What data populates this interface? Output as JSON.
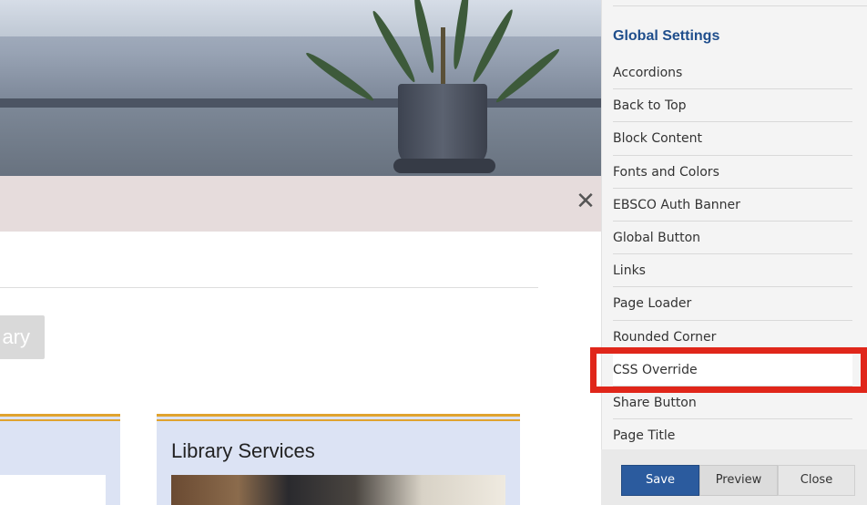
{
  "alert": {
    "close_glyph": "✕"
  },
  "page": {
    "button_partial_label": "ary",
    "card_title": "Library Services"
  },
  "panel": {
    "heading": "Global Settings",
    "items": [
      "Accordions",
      "Back to Top",
      "Block Content",
      "Fonts and Colors",
      "EBSCO Auth Banner",
      "Global Button",
      "Links",
      "Page Loader",
      "Rounded Corner",
      "CSS Override",
      "Share Button",
      "Page Title"
    ],
    "highlighted_item": "CSS Override",
    "highlight_color": "#e0261a"
  },
  "footer": {
    "save_label": "Save",
    "preview_label": "Preview",
    "close_label": "Close"
  },
  "colors": {
    "accent": "#2b5b9e",
    "heading": "#1f4e8c",
    "card_stripe": "#e0a32e",
    "card_bg": "#dce3f4",
    "alert_bg": "#e6dcdc"
  }
}
